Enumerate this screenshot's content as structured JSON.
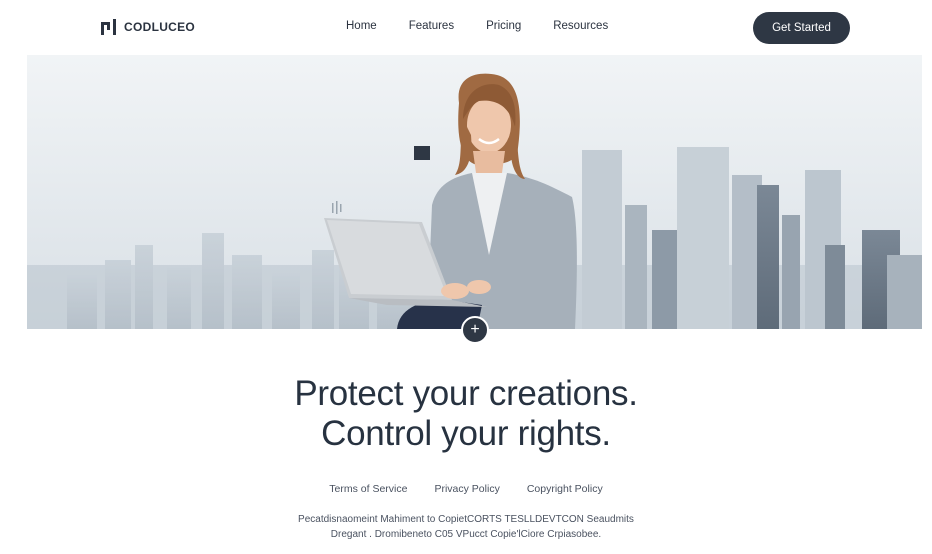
{
  "header": {
    "logo_text": "CODLUCEO",
    "nav": [
      "Home",
      "Features",
      "Pricing",
      "Resources"
    ],
    "cta_label": "Get Started"
  },
  "hero": {
    "image": "woman-with-laptop-city-skyline"
  },
  "headline": {
    "line1": "Protect your creations.",
    "line2": "Control your rights."
  },
  "footer": {
    "links": [
      "Terms of Service",
      "Privacy Policy",
      "Copyright Policy"
    ],
    "fine_line1": "Pecatdisnaomeint Mahiment to CopietCORTS  TESLLDEVTCON Seaudmits",
    "fine_line2": "Dregant . Dromibeneto C05 VPucct Copie'lCiore Crpiasobee."
  },
  "colors": {
    "accent": "#2e3744",
    "text": "#273240",
    "background": "#ffffff"
  }
}
